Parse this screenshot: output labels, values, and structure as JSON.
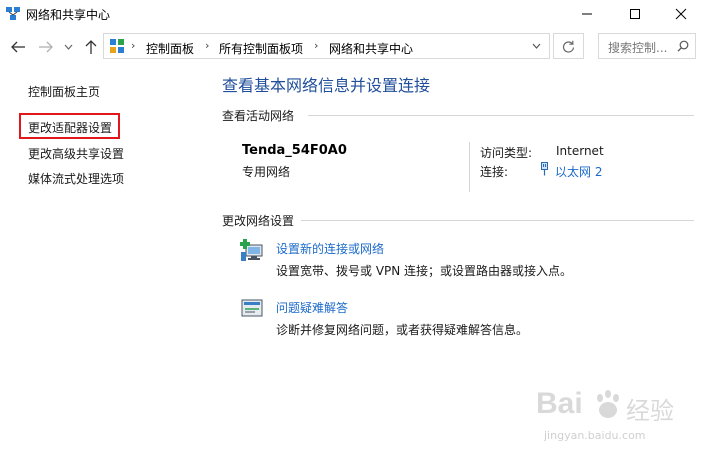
{
  "window": {
    "title": "网络和共享中心",
    "icons": [
      "network-sharing-icon",
      "minimize-icon",
      "maximize-icon",
      "close-icon"
    ]
  },
  "nav": {
    "back_icon": "arrow-left-icon",
    "forward_icon": "arrow-right-icon",
    "recent_icon": "chevron-down-icon",
    "up_icon": "arrow-up-icon",
    "breadcrumbs": [
      "控制面板",
      "所有控制面板项",
      "网络和共享中心"
    ],
    "refresh_icon": "refresh-icon",
    "search_placeholder": "搜索控制..."
  },
  "sidebar": {
    "items": [
      {
        "label": "控制面板主页"
      },
      {
        "label": "更改适配器设置",
        "highlighted": true
      },
      {
        "label": "更改高级共享设置"
      },
      {
        "label": "媒体流式处理选项"
      }
    ],
    "highlight_color": "#e0181c"
  },
  "main": {
    "title": "查看基本网络信息并设置连接",
    "active_section": "查看活动网络",
    "network": {
      "name": "Tenda_54F0A0",
      "type": "专用网络",
      "access_label": "访问类型:",
      "access_value": "Internet",
      "conn_label": "连接:",
      "conn_value": "以太网 2"
    },
    "change_section": "更改网络设置",
    "tasks": [
      {
        "link": "设置新的连接或网络",
        "desc": "设置宽带、拨号或 VPN 连接；或设置路由器或接入点。",
        "icon": "new-connection-icon"
      },
      {
        "link": "问题疑难解答",
        "desc": "诊断并修复网络问题，或者获得疑难解答信息。",
        "icon": "troubleshoot-icon"
      }
    ]
  },
  "watermark": {
    "brand_left": "Bai",
    "brand_right": "经验",
    "url": "jingyan.baidu.com"
  },
  "colors": {
    "title_blue": "#1f4e9a",
    "link_blue": "#1b6ac9"
  }
}
